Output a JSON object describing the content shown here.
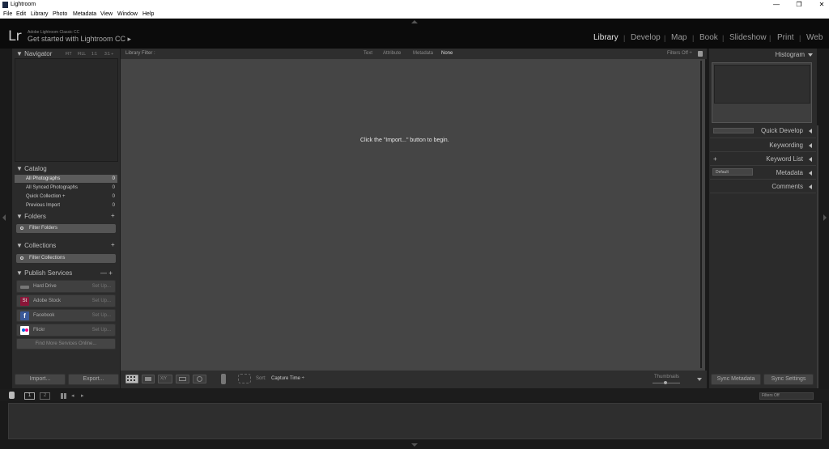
{
  "window": {
    "title": "Lightroom",
    "minimize": "—",
    "maximize": "❐",
    "close": "✕"
  },
  "menu": [
    "File",
    "Edit",
    "Library",
    "Photo",
    "Metadata",
    "View",
    "Window",
    "Help"
  ],
  "identity": {
    "logo": "Lr",
    "product": "Adobe Lightroom Classic CC",
    "tagline": "Get started with Lightroom CC ▸"
  },
  "modules": [
    "Library",
    "Develop",
    "Map",
    "Book",
    "Slideshow",
    "Print",
    "Web"
  ],
  "module_separator": "|",
  "navigator": {
    "title": "Navigator",
    "zoom": [
      "FIT",
      "FILL",
      "1:1",
      "3:1 ÷"
    ]
  },
  "catalog": {
    "title": "Catalog",
    "items": [
      {
        "label": "All Photographs",
        "count": "0"
      },
      {
        "label": "All Synced Photographs",
        "count": "0"
      },
      {
        "label": "Quick Collection +",
        "count": "0"
      },
      {
        "label": "Previous Import",
        "count": "0"
      }
    ]
  },
  "folders": {
    "title": "Folders",
    "filter": "Filter Folders",
    "add": "+"
  },
  "collections": {
    "title": "Collections",
    "filter": "Filter Collections",
    "add": "+"
  },
  "publish": {
    "title": "Publish Services",
    "controls": "— +",
    "services": [
      {
        "label": "Hard Drive",
        "setup": "Set Up...",
        "color": "#777777"
      },
      {
        "label": "Adobe Stock",
        "setup": "Set Up...",
        "color": "#8a1538"
      },
      {
        "label": "Facebook",
        "setup": "Set Up...",
        "color": "#3b5998"
      },
      {
        "label": "Flickr",
        "setup": "Set Up...",
        "color": "#ffffff"
      }
    ],
    "find_more": "Find More Services Online..."
  },
  "buttons": {
    "import": "Import...",
    "export": "Export...",
    "sync_metadata": "Sync Metadata",
    "sync_settings": "Sync Settings"
  },
  "library_filter": {
    "label": "Library Filter :",
    "tabs": [
      "Text",
      "Attribute",
      "Metadata",
      "None"
    ],
    "filters_off": "Filters Off ÷",
    "lock": "🔒"
  },
  "grid": {
    "message": "Click the \"Import...\" button to begin."
  },
  "toolbar": {
    "sort_label": "Sort:",
    "sort_value": "Capture Time ÷",
    "thumbnails": "Thumbnails",
    "painter": "ⵓ",
    "loupe": "◉"
  },
  "right": {
    "histogram": "Histogram",
    "quick_develop": "Quick Develop",
    "keywording": "Keywording",
    "keyword_list": "Keyword List",
    "keyword_add": "+",
    "metadata": "Metadata",
    "metadata_preset": "Default",
    "comments": "Comments"
  },
  "filmstrip": {
    "pages": [
      "1",
      "2"
    ],
    "filters_off": "Filters Off"
  }
}
